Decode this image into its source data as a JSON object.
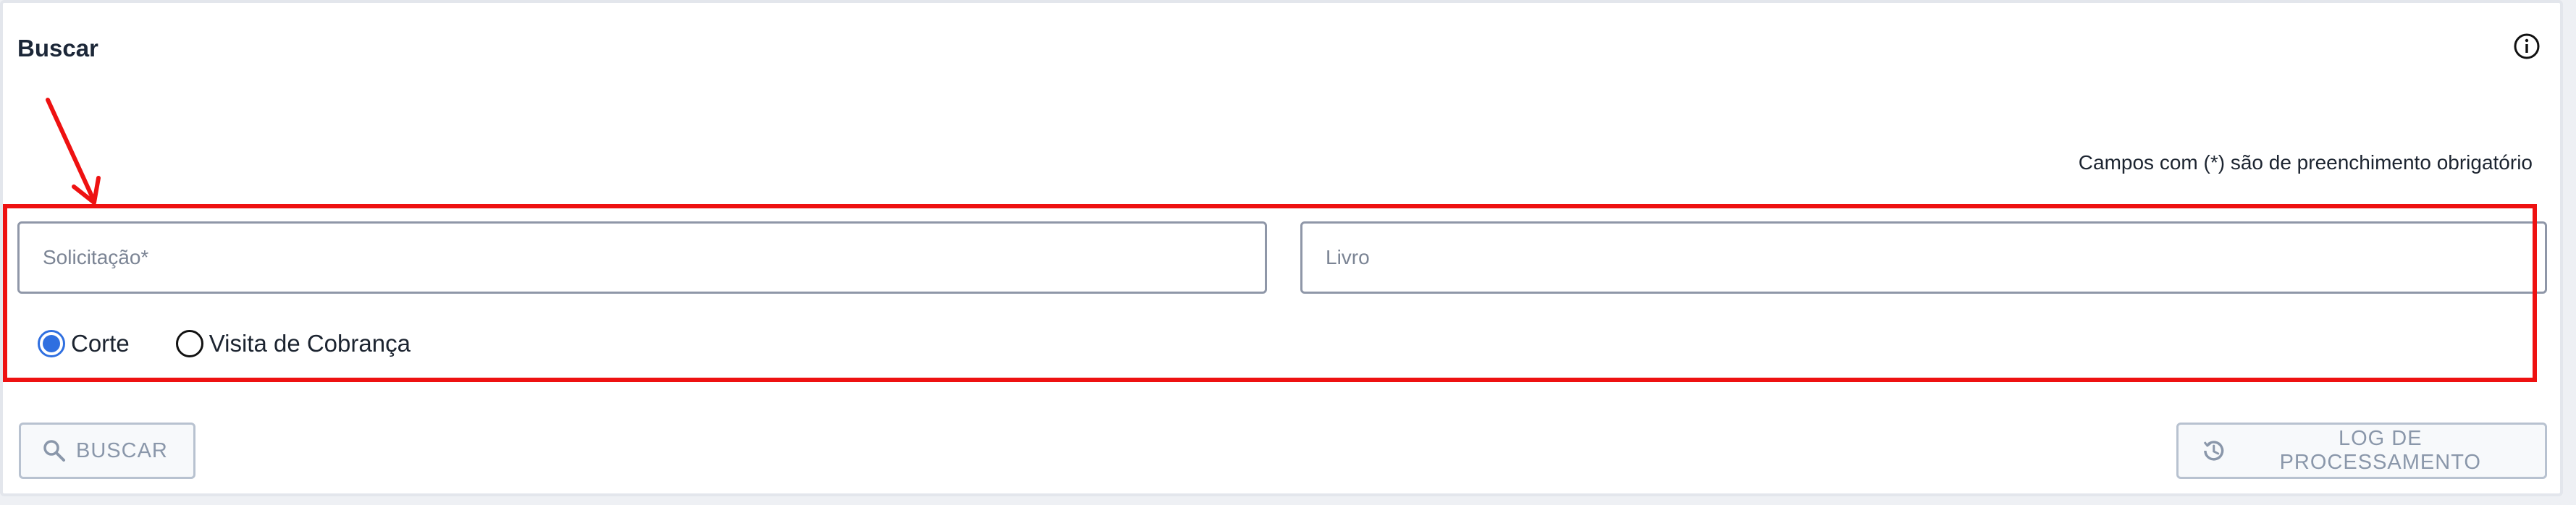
{
  "header": {
    "title": "Buscar",
    "info_icon": "info-icon"
  },
  "form": {
    "required_note": "Campos com (*) são de preenchimento obrigatório",
    "solicitacao": {
      "placeholder": "Solicitação*",
      "value": ""
    },
    "livro": {
      "placeholder": "Livro",
      "value": ""
    },
    "radio_options": [
      {
        "label": "Corte",
        "checked": true
      },
      {
        "label": "Visita de Cobrança",
        "checked": false
      }
    ]
  },
  "actions": {
    "search_label": "BUSCAR",
    "search_icon": "search-icon",
    "log_label": "LOG DE PROCESSAMENTO",
    "log_icon": "history-icon"
  },
  "annotation": {
    "color": "#ee1111"
  },
  "colors": {
    "accent": "#2f6fe0",
    "button_text": "#8a97aa"
  }
}
